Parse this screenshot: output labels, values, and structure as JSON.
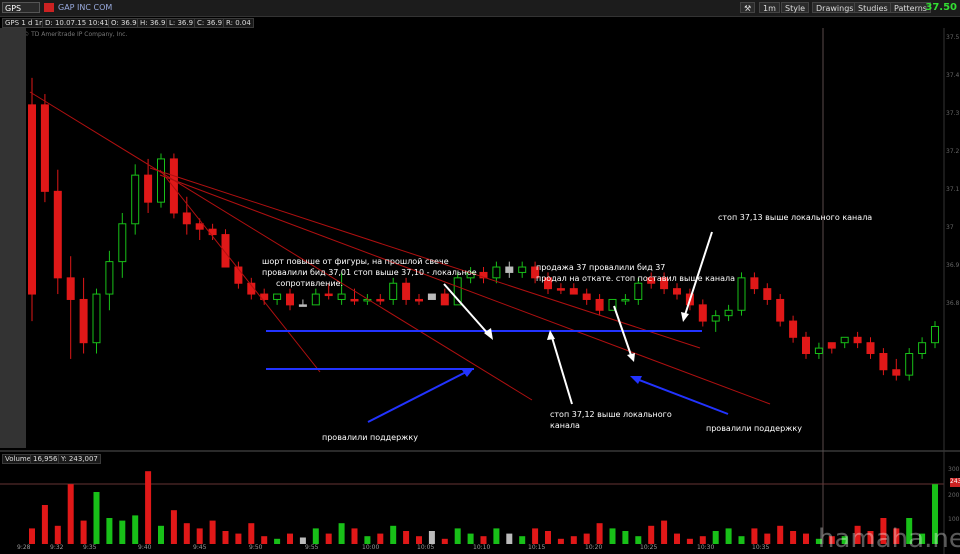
{
  "toolbar": {
    "symbol": "GPS",
    "company": "GAP INC COM",
    "aggregation": "1m",
    "style_label": "Style",
    "drawings_label": "Drawings",
    "studies_label": "Studies",
    "patterns_label": "Patterns",
    "last_price": "37.50",
    "colors": {
      "price": "#33dd33",
      "flag": "#cc2222"
    }
  },
  "info": {
    "title": "GPS 1 d 1m",
    "date": "D: 10.07.15 10:41",
    "open": "O: 36.94",
    "high": "H: 36.95",
    "low": "L: 36.91",
    "close": "C: 36.91",
    "range": "R: 0.04"
  },
  "copyright": "2015 © TD Ameritrade IP Company, Inc.",
  "price_axis": [
    "37.5",
    "37.4",
    "37.3",
    "37.2",
    "37.1",
    "37",
    "36.9",
    "36.8"
  ],
  "volume": {
    "label": "Volume",
    "value": "16,956",
    "cursor": "Y: 243,007",
    "axis": [
      "300",
      "243",
      "200",
      "100"
    ]
  },
  "time_axis": [
    "9:28",
    "9:32",
    "9:35",
    "9:40",
    "9:45",
    "9:50",
    "9:55",
    "10:00",
    "10:05",
    "10:10",
    "10:15",
    "10:20",
    "10:25",
    "10:30",
    "10:35"
  ],
  "annotations": {
    "short_note_1": "шорт повыше от фигуры, на прошлой свече",
    "short_note_2": "провалили бид 37,01 стоп выше 37,10 - локальное",
    "short_note_3": "сопротивление.",
    "support_1": "провалили поддержку",
    "stop_1_line1": "стоп 37,12 выше локального",
    "stop_1_line2": "канала",
    "sale_1": "продажа 37 провалили бид 37",
    "sale_2": "продал на откате. стоп поставил выше канала",
    "stop_2": "стоп 37,13 выше локального канала",
    "support_2": "провалили поддержку"
  },
  "watermark": "hamaha.net",
  "chart_data": {
    "type": "candlestick",
    "candles": [
      {
        "o": 37.05,
        "h": 37.45,
        "l": 37.0,
        "c": 37.4,
        "color": "red"
      },
      {
        "o": 37.4,
        "h": 37.42,
        "l": 37.22,
        "c": 37.24,
        "color": "red"
      },
      {
        "o": 37.24,
        "h": 37.28,
        "l": 37.05,
        "c": 37.08,
        "color": "red"
      },
      {
        "o": 37.08,
        "h": 37.12,
        "l": 36.93,
        "c": 37.04,
        "color": "red"
      },
      {
        "o": 37.04,
        "h": 37.08,
        "l": 36.94,
        "c": 36.96,
        "color": "red"
      },
      {
        "o": 36.96,
        "h": 37.06,
        "l": 36.94,
        "c": 37.05,
        "color": "green"
      },
      {
        "o": 37.05,
        "h": 37.13,
        "l": 37.02,
        "c": 37.11,
        "color": "green"
      },
      {
        "o": 37.11,
        "h": 37.2,
        "l": 37.08,
        "c": 37.18,
        "color": "green"
      },
      {
        "o": 37.18,
        "h": 37.29,
        "l": 37.16,
        "c": 37.27,
        "color": "green"
      },
      {
        "o": 37.27,
        "h": 37.3,
        "l": 37.2,
        "c": 37.22,
        "color": "red"
      },
      {
        "o": 37.22,
        "h": 37.31,
        "l": 37.21,
        "c": 37.3,
        "color": "green"
      },
      {
        "o": 37.3,
        "h": 37.31,
        "l": 37.19,
        "c": 37.2,
        "color": "red"
      },
      {
        "o": 37.2,
        "h": 37.23,
        "l": 37.16,
        "c": 37.18,
        "color": "red"
      },
      {
        "o": 37.18,
        "h": 37.19,
        "l": 37.15,
        "c": 37.17,
        "color": "red"
      },
      {
        "o": 37.17,
        "h": 37.18,
        "l": 37.15,
        "c": 37.16,
        "color": "red"
      },
      {
        "o": 37.16,
        "h": 37.17,
        "l": 37.1,
        "c": 37.1,
        "color": "red"
      },
      {
        "o": 37.1,
        "h": 37.11,
        "l": 37.06,
        "c": 37.07,
        "color": "red"
      },
      {
        "o": 37.07,
        "h": 37.08,
        "l": 37.04,
        "c": 37.05,
        "color": "red"
      },
      {
        "o": 37.05,
        "h": 37.06,
        "l": 37.03,
        "c": 37.04,
        "color": "red"
      },
      {
        "o": 37.04,
        "h": 37.05,
        "l": 37.03,
        "c": 37.05,
        "color": "green"
      },
      {
        "o": 37.05,
        "h": 37.06,
        "l": 37.02,
        "c": 37.03,
        "color": "red"
      },
      {
        "o": 37.03,
        "h": 37.04,
        "l": 37.03,
        "c": 37.03,
        "color": "white"
      },
      {
        "o": 37.03,
        "h": 37.06,
        "l": 37.03,
        "c": 37.05,
        "color": "green"
      },
      {
        "o": 37.05,
        "h": 37.07,
        "l": 37.04,
        "c": 37.05,
        "color": "red"
      },
      {
        "o": 37.05,
        "h": 37.09,
        "l": 37.03,
        "c": 37.04,
        "color": "green"
      },
      {
        "o": 37.04,
        "h": 37.06,
        "l": 37.03,
        "c": 37.04,
        "color": "red"
      },
      {
        "o": 37.04,
        "h": 37.05,
        "l": 37.03,
        "c": 37.04,
        "color": "green"
      },
      {
        "o": 37.04,
        "h": 37.05,
        "l": 37.03,
        "c": 37.04,
        "color": "red"
      },
      {
        "o": 37.04,
        "h": 37.08,
        "l": 37.03,
        "c": 37.07,
        "color": "green"
      },
      {
        "o": 37.07,
        "h": 37.08,
        "l": 37.03,
        "c": 37.04,
        "color": "red"
      },
      {
        "o": 37.04,
        "h": 37.05,
        "l": 37.03,
        "c": 37.04,
        "color": "red"
      },
      {
        "o": 37.04,
        "h": 37.05,
        "l": 37.04,
        "c": 37.05,
        "color": "white"
      },
      {
        "o": 37.05,
        "h": 37.06,
        "l": 37.03,
        "c": 37.03,
        "color": "red"
      },
      {
        "o": 37.03,
        "h": 37.09,
        "l": 37.03,
        "c": 37.08,
        "color": "green"
      },
      {
        "o": 37.08,
        "h": 37.1,
        "l": 37.07,
        "c": 37.09,
        "color": "green"
      },
      {
        "o": 37.09,
        "h": 37.1,
        "l": 37.07,
        "c": 37.08,
        "color": "red"
      },
      {
        "o": 37.08,
        "h": 37.11,
        "l": 37.07,
        "c": 37.1,
        "color": "green"
      },
      {
        "o": 37.1,
        "h": 37.11,
        "l": 37.08,
        "c": 37.09,
        "color": "white"
      },
      {
        "o": 37.09,
        "h": 37.11,
        "l": 37.08,
        "c": 37.1,
        "color": "green"
      },
      {
        "o": 37.1,
        "h": 37.11,
        "l": 37.07,
        "c": 37.08,
        "color": "red"
      },
      {
        "o": 37.08,
        "h": 37.09,
        "l": 37.05,
        "c": 37.06,
        "color": "red"
      },
      {
        "o": 37.06,
        "h": 37.07,
        "l": 37.05,
        "c": 37.06,
        "color": "red"
      },
      {
        "o": 37.06,
        "h": 37.07,
        "l": 37.05,
        "c": 37.05,
        "color": "red"
      },
      {
        "o": 37.05,
        "h": 37.06,
        "l": 37.03,
        "c": 37.04,
        "color": "red"
      },
      {
        "o": 37.04,
        "h": 37.05,
        "l": 37.01,
        "c": 37.02,
        "color": "red"
      },
      {
        "o": 37.02,
        "h": 37.04,
        "l": 37.02,
        "c": 37.04,
        "color": "green"
      },
      {
        "o": 37.04,
        "h": 37.05,
        "l": 37.03,
        "c": 37.04,
        "color": "green"
      },
      {
        "o": 37.04,
        "h": 37.08,
        "l": 37.03,
        "c": 37.07,
        "color": "green"
      },
      {
        "o": 37.07,
        "h": 37.09,
        "l": 37.06,
        "c": 37.08,
        "color": "red"
      },
      {
        "o": 37.08,
        "h": 37.09,
        "l": 37.05,
        "c": 37.06,
        "color": "red"
      },
      {
        "o": 37.06,
        "h": 37.07,
        "l": 37.04,
        "c": 37.05,
        "color": "red"
      },
      {
        "o": 37.05,
        "h": 37.06,
        "l": 37.02,
        "c": 37.03,
        "color": "red"
      },
      {
        "o": 37.03,
        "h": 37.04,
        "l": 36.99,
        "c": 37.0,
        "color": "red"
      },
      {
        "o": 37.0,
        "h": 37.02,
        "l": 36.98,
        "c": 37.01,
        "color": "green"
      },
      {
        "o": 37.01,
        "h": 37.03,
        "l": 37.0,
        "c": 37.02,
        "color": "green"
      },
      {
        "o": 37.02,
        "h": 37.09,
        "l": 37.01,
        "c": 37.08,
        "color": "green"
      },
      {
        "o": 37.08,
        "h": 37.09,
        "l": 37.05,
        "c": 37.06,
        "color": "red"
      },
      {
        "o": 37.06,
        "h": 37.07,
        "l": 37.03,
        "c": 37.04,
        "color": "red"
      },
      {
        "o": 37.04,
        "h": 37.05,
        "l": 36.99,
        "c": 37.0,
        "color": "red"
      },
      {
        "o": 37.0,
        "h": 37.01,
        "l": 36.96,
        "c": 36.97,
        "color": "red"
      },
      {
        "o": 36.97,
        "h": 36.98,
        "l": 36.93,
        "c": 36.94,
        "color": "red"
      },
      {
        "o": 36.94,
        "h": 36.96,
        "l": 36.93,
        "c": 36.95,
        "color": "green"
      },
      {
        "o": 36.95,
        "h": 36.96,
        "l": 36.94,
        "c": 36.96,
        "color": "red"
      },
      {
        "o": 36.96,
        "h": 36.97,
        "l": 36.95,
        "c": 36.97,
        "color": "green"
      },
      {
        "o": 36.97,
        "h": 36.98,
        "l": 36.95,
        "c": 36.96,
        "color": "red"
      },
      {
        "o": 36.96,
        "h": 36.97,
        "l": 36.93,
        "c": 36.94,
        "color": "red"
      },
      {
        "o": 36.94,
        "h": 36.95,
        "l": 36.9,
        "c": 36.91,
        "color": "red"
      },
      {
        "o": 36.91,
        "h": 36.93,
        "l": 36.89,
        "c": 36.9,
        "color": "red"
      },
      {
        "o": 36.9,
        "h": 36.95,
        "l": 36.89,
        "c": 36.94,
        "color": "green"
      },
      {
        "o": 36.94,
        "h": 36.97,
        "l": 36.93,
        "c": 36.96,
        "color": "green"
      },
      {
        "o": 36.96,
        "h": 37.0,
        "l": 36.95,
        "c": 36.99,
        "color": "green"
      }
    ],
    "volume": [
      60,
      150,
      70,
      230,
      90,
      200,
      100,
      90,
      110,
      280,
      70,
      130,
      80,
      60,
      90,
      50,
      40,
      80,
      30,
      20,
      40,
      25,
      60,
      40,
      80,
      60,
      30,
      40,
      70,
      50,
      30,
      50,
      20,
      60,
      40,
      30,
      60,
      40,
      30,
      60,
      50,
      20,
      30,
      40,
      80,
      60,
      50,
      30,
      70,
      90,
      40,
      20,
      30,
      50,
      60,
      30,
      60,
      40,
      70,
      50,
      40,
      20,
      30,
      30,
      70,
      50,
      100,
      60,
      100,
      40,
      230
    ],
    "y_range": [
      36.78,
      37.52
    ]
  }
}
